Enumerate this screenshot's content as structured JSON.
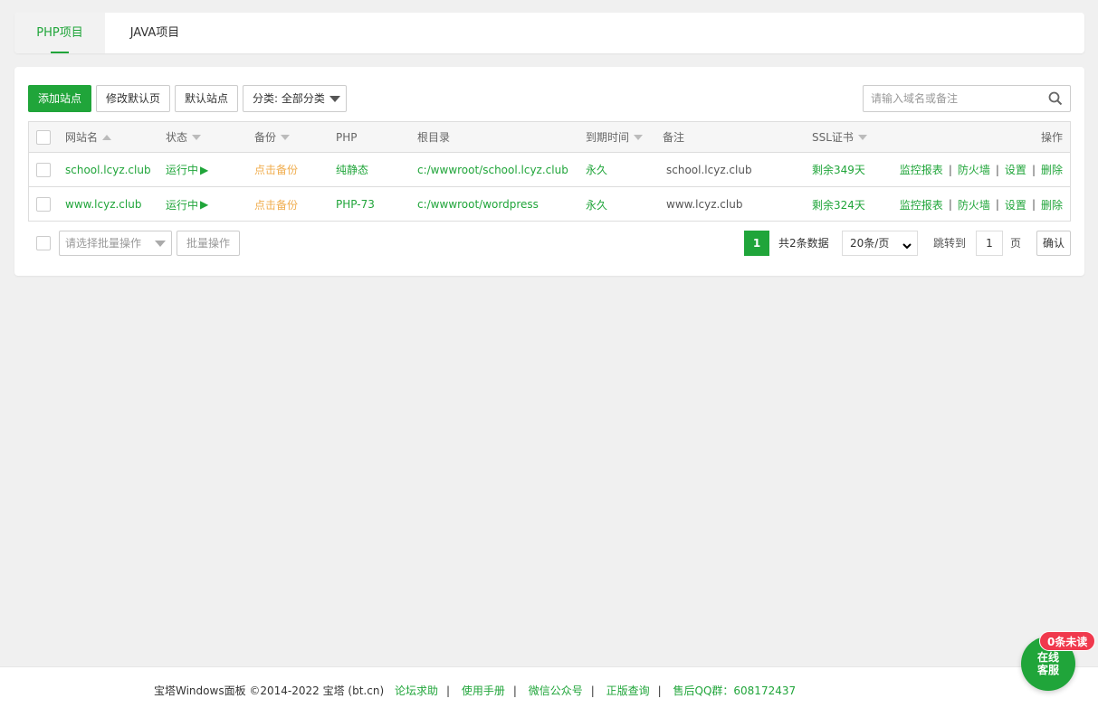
{
  "tabs": [
    {
      "label": "PHP项目",
      "active": true
    },
    {
      "label": "JAVA项目",
      "active": false
    }
  ],
  "toolbar": {
    "add_site": "添加站点",
    "edit_default_page": "修改默认页",
    "default_site": "默认站点",
    "category": "分类: 全部分类"
  },
  "search": {
    "placeholder": "请输入域名或备注"
  },
  "table": {
    "headers": {
      "site": "网站名",
      "status": "状态",
      "backup": "备份",
      "php": "PHP",
      "root": "根目录",
      "expire": "到期时间",
      "remark": "备注",
      "ssl": "SSL证书",
      "ops": "操作"
    },
    "rows": [
      {
        "site": "school.lcyz.club",
        "status": "运行中",
        "backup": "点击备份",
        "php": "纯静态",
        "root": "c:/wwwroot/school.lcyz.club",
        "expire": "永久",
        "remark": "school.lcyz.club",
        "ssl": "剩余349天"
      },
      {
        "site": "www.lcyz.club",
        "status": "运行中",
        "backup": "点击备份",
        "php": "PHP-73",
        "root": "c:/wwwroot/wordpress",
        "expire": "永久",
        "remark": "www.lcyz.club",
        "ssl": "剩余324天"
      }
    ],
    "ops": {
      "monitor": "监控报表",
      "firewall": "防火墙",
      "settings": "设置",
      "delete": "删除",
      "sep": "|"
    }
  },
  "batch": {
    "placeholder": "请选择批量操作",
    "button": "批量操作"
  },
  "pagination": {
    "current": "1",
    "total": "共2条数据",
    "per_page": "20条/页",
    "jump_label": "跳转到",
    "jump_value": "1",
    "page_suffix": "页",
    "confirm": "确认"
  },
  "footer": {
    "copyright": "宝塔Windows面板 ©2014-2022 宝塔 (bt.cn)",
    "links": [
      "论坛求助",
      "使用手册",
      "微信公众号",
      "正版查询",
      "售后QQ群：608172437"
    ],
    "sep": "|"
  },
  "chat": {
    "line1": "在线",
    "line2": "客服",
    "badge": "0条未读"
  },
  "colors": {
    "accent": "#20a53a",
    "backup": "#f0ad4e",
    "badge": "#f0394d"
  },
  "icons": {
    "status_running": "play-icon",
    "search": "search-icon"
  }
}
